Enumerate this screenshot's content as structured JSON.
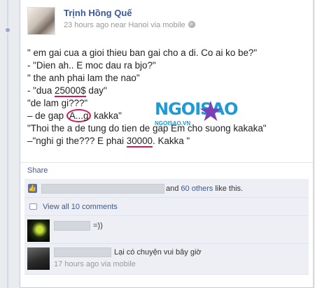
{
  "post": {
    "author": "Trịnh Hồng Quế",
    "meta": "23 hours ago near Hanoi via mobile",
    "lines": [
      {
        "pre": "\" em gai cua a gioi thieu ban gai cho a di. Co ai ko be?\""
      },
      {
        "pre": "- \"Dien ah.. E moc dau ra bjo?\""
      },
      {
        "pre": "\" the anh phai lam the nao\""
      },
      {
        "pre": "- \"dua ",
        "mark": "25000$",
        "post": " day\""
      },
      {
        "pre": "\"de lam gi???\""
      },
      {
        "pre": "– de gap ",
        "circle": "A...g",
        "post": " kakka\""
      },
      {
        "pre": "\"Thoi the a de tung do tien de gap Em cho suong kakaka\""
      },
      {
        "pre": "–\"nghi gi the??? E phai ",
        "mark": "30000",
        "post": ". Kakka \""
      }
    ]
  },
  "watermark": {
    "brand": "NGOISAO",
    "domain": "NGOISAO.VN"
  },
  "actions": {
    "share": "Share"
  },
  "likes": {
    "text_and": "and ",
    "others_link": "60 others",
    "text_suffix": " like this."
  },
  "view_all": "View all 10 comments",
  "comments": [
    {
      "text": "=))"
    },
    {
      "text": "Lại có chuyện vui bây giờ",
      "meta": "17 hours ago via mobile"
    }
  ],
  "colors": {
    "link": "#3b5998",
    "highlight": "#d11a5a",
    "ufi_bg": "#edeff4"
  }
}
